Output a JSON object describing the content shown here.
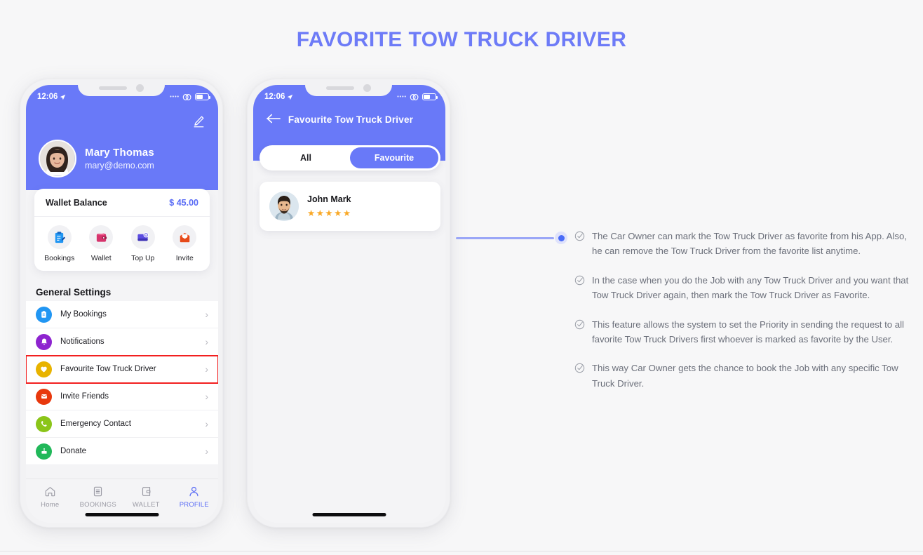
{
  "page": {
    "title": "FAVORITE TOW TRUCK DRIVER",
    "accent_color": "#6979f8",
    "title_color": "#6d7bf7",
    "background": "#f7f7f8"
  },
  "phone1": {
    "status_bar": {
      "time": "12:06",
      "location_icon": "location-arrow-icon",
      "signal_icon": "link-icon",
      "battery_icon": "battery-icon"
    },
    "header": {
      "edit_icon": "pencil-edit-icon",
      "avatar": "user-avatar-mary",
      "name": "Mary Thomas",
      "email": "mary@demo.com"
    },
    "wallet": {
      "label": "Wallet Balance",
      "amount": "$ 45.00",
      "actions": [
        {
          "label": "Bookings",
          "icon": "clipboard-pen-icon",
          "color": "#2196f3"
        },
        {
          "label": "Wallet",
          "icon": "wallet-icon",
          "color": "#d6336c"
        },
        {
          "label": "Top Up",
          "icon": "card-plus-icon",
          "color": "#5b4ce0"
        },
        {
          "label": "Invite",
          "icon": "envelope-icon",
          "color": "#f4511e"
        }
      ]
    },
    "settings": {
      "title": "General Settings",
      "items": [
        {
          "label": "My Bookings",
          "icon": "clipboard-pen-icon",
          "color": "#2196f3",
          "highlighted": false
        },
        {
          "label": "Notifications",
          "icon": "bell-icon",
          "color": "#8e24cf",
          "highlighted": false
        },
        {
          "label": "Favourite Tow Truck Driver",
          "icon": "heart-icon",
          "color": "#e8b300",
          "highlighted": true
        },
        {
          "label": "Invite Friends",
          "icon": "envelope-icon",
          "color": "#e8380d",
          "highlighted": false
        },
        {
          "label": "Emergency Contact",
          "icon": "phone-icon",
          "color": "#8bc519",
          "highlighted": false
        },
        {
          "label": "Donate",
          "icon": "donate-hand-icon",
          "color": "#21b85a",
          "highlighted": false
        }
      ],
      "chevron": "›",
      "highlight_color": "#f21f1f"
    },
    "tabbar": {
      "items": [
        {
          "label": "Home",
          "icon": "home-icon",
          "active": false
        },
        {
          "label": "BOOKINGS",
          "icon": "list-icon",
          "active": false
        },
        {
          "label": "WALLET",
          "icon": "wallet-outline-icon",
          "active": false
        },
        {
          "label": "PROFILE",
          "icon": "person-icon",
          "active": true
        }
      ],
      "active_color": "#5a6cf5"
    }
  },
  "phone2": {
    "status_bar": {
      "time": "12:06",
      "location_icon": "location-arrow-icon",
      "signal_icon": "link-icon",
      "battery_icon": "battery-icon"
    },
    "nav": {
      "back_icon": "back-arrow-icon",
      "title": "Favourite Tow Truck Driver"
    },
    "segments": [
      {
        "label": "All",
        "active": false
      },
      {
        "label": "Favourite",
        "active": true
      }
    ],
    "driver": {
      "avatar": "user-avatar-john",
      "favorite_badge": "heart-badge-icon",
      "name": "John Mark",
      "stars": "★★★★★",
      "rating": 5,
      "star_color": "#f9a826"
    }
  },
  "callout": {
    "dot_color": "#4a6cf7",
    "line_color": "#9aa6f7",
    "bullets": [
      "The Car Owner can mark the Tow Truck Driver as favorite from his App. Also, he can remove the Tow Truck Driver from the favorite list anytime.",
      "In the case when you do the Job with any Tow Truck Driver and you want that Tow Truck Driver again, then mark the Tow Truck Driver as Favorite.",
      "This feature allows the system to set the Priority in sending the request to all favorite Tow Truck Drivers first whoever is marked as favorite by the User.",
      "This way Car Owner gets the chance to book the Job with any specific Tow Truck Driver."
    ],
    "bullet_icon": "check-circle-icon"
  }
}
